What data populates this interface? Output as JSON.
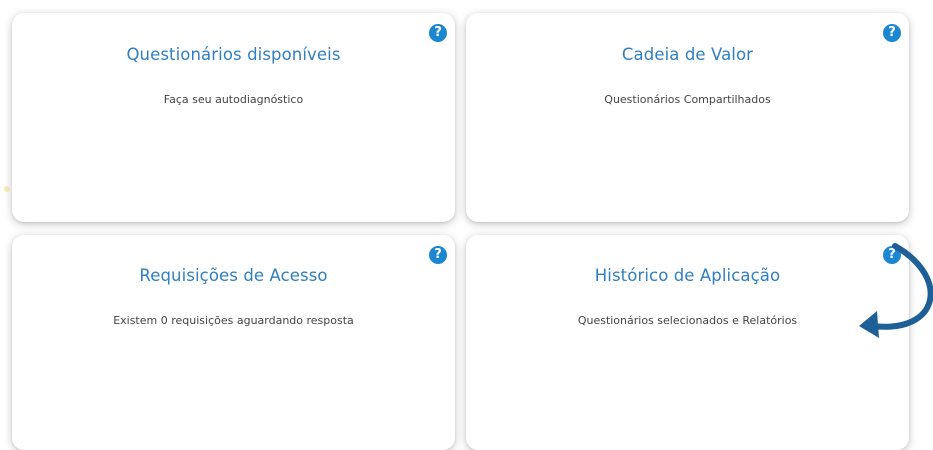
{
  "cards": [
    {
      "title": "Questionários disponíveis",
      "subtitle": "Faça seu autodiagnóstico",
      "help_icon": "question-circle-icon",
      "help_label": "?"
    },
    {
      "title": "Cadeia de Valor",
      "subtitle": "Questionários Compartilhados",
      "help_icon": "question-circle-icon",
      "help_label": "?"
    },
    {
      "title": "Requisições de Acesso",
      "subtitle": "Existem 0 requisições aguardando resposta",
      "help_icon": "question-circle-icon",
      "help_label": "?"
    },
    {
      "title": "Histórico de Aplicação",
      "subtitle": "Questionários selecionados e Relatórios",
      "help_icon": "question-circle-icon",
      "help_label": "?"
    }
  ],
  "annotation": {
    "icon": "curved-arrow-icon",
    "color": "#1f5f97"
  },
  "colors": {
    "title": "#2f7fc1",
    "help_icon": "#1c87d1",
    "subtitle": "#444444"
  }
}
